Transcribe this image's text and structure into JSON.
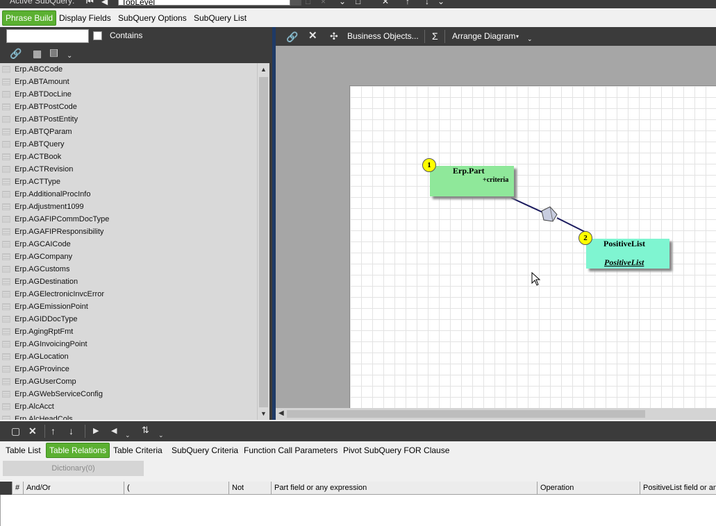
{
  "top": {
    "active_subquery_label": "Active SubQuery:",
    "subquery_value": "TopLevel"
  },
  "main_tabs": [
    {
      "label": "Phrase Build",
      "active": true
    },
    {
      "label": "Display Fields",
      "active": false
    },
    {
      "label": "SubQuery Options",
      "active": false
    },
    {
      "label": "SubQuery List",
      "active": false
    }
  ],
  "left_panel": {
    "search_value": "",
    "contains_label": "Contains",
    "tables": [
      "Erp.ABCCode",
      "Erp.ABTAmount",
      "Erp.ABTDocLine",
      "Erp.ABTPostCode",
      "Erp.ABTPostEntity",
      "Erp.ABTQParam",
      "Erp.ABTQuery",
      "Erp.ACTBook",
      "Erp.ACTRevision",
      "Erp.ACTType",
      "Erp.AdditionalProcInfo",
      "Erp.Adjustment1099",
      "Erp.AGAFIPCommDocType",
      "Erp.AGAFIPResponsibility",
      "Erp.AGCAICode",
      "Erp.AGCompany",
      "Erp.AGCustoms",
      "Erp.AGDestination",
      "Erp.AGElectronicInvcError",
      "Erp.AGEmissionPoint",
      "Erp.AGIDDocType",
      "Erp.AgingRptFmt",
      "Erp.AGInvoicingPoint",
      "Erp.AGLocation",
      "Erp.AGProvince",
      "Erp.AGUserComp",
      "Erp.AGWebServiceConfig",
      "Erp.AlcAcct",
      "Erp.AlcHeadCols"
    ]
  },
  "diagram_toolbar": {
    "business_objects_label": "Business Objects...",
    "sigma_label": "Σ",
    "arrange_label": "Arrange Diagram"
  },
  "diagram": {
    "entities": [
      {
        "badge": "1",
        "name": "Erp.Part",
        "sub": "+criteria"
      },
      {
        "badge": "2",
        "name": "PositiveList",
        "sub": "PositiveList"
      }
    ]
  },
  "bottom_tabs": [
    {
      "label": "Table List",
      "active": false
    },
    {
      "label": "Table Relations",
      "active": true
    },
    {
      "label": "Table Criteria",
      "active": false
    },
    {
      "label": "SubQuery Criteria",
      "active": false
    },
    {
      "label": "Function Call Parameters",
      "active": false
    },
    {
      "label": "Pivot SubQuery FOR Clause",
      "active": false
    }
  ],
  "dictionary_label": "Dictionary(0)",
  "grid_columns": [
    "#",
    "And/Or",
    "(",
    "Not",
    "Part field or any expression",
    "Operation",
    "PositiveList field or any expression"
  ],
  "colors": {
    "accent_green": "#5bb031",
    "toolbar_dark": "#3b3b3b",
    "entity_part": "#8fe89a",
    "entity_positivelist": "#7ff5d1",
    "badge": "#ffff00"
  }
}
